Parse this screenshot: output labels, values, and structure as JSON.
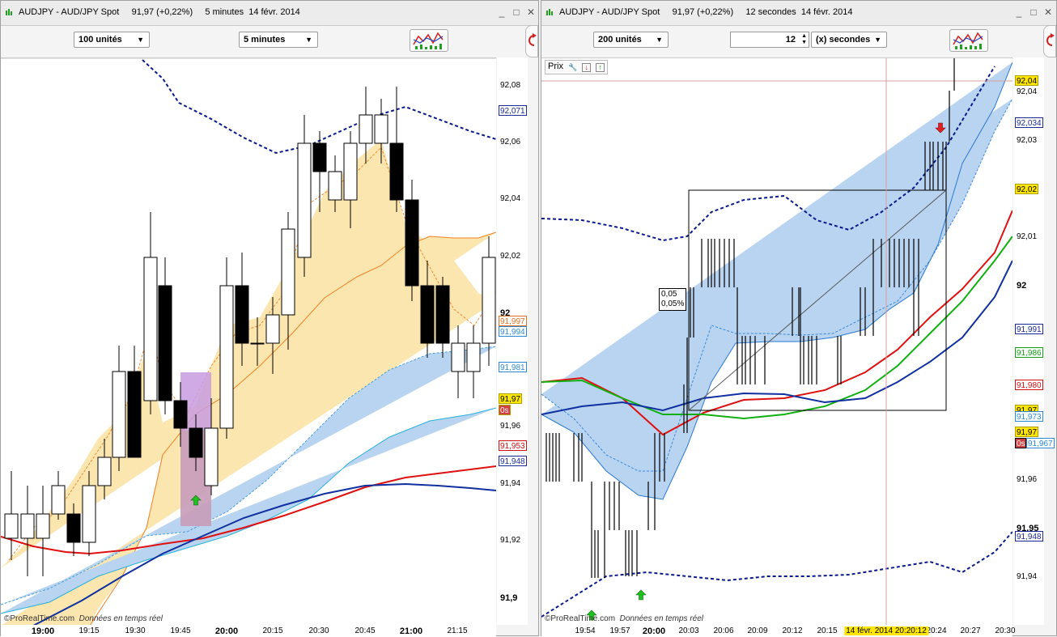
{
  "colors": {
    "bull_candle": "#ffffff",
    "bear_candle": "#000000",
    "bollinger": "#0a1a8c",
    "red_ma": "#e01010",
    "green_ma": "#10b010",
    "blue_ma": "#1030a0",
    "cloud_blue": "#b8d4f0",
    "cloud_yellow": "#fbe6b0",
    "orange_line": "#f08020",
    "highlight_purple": "#c89be0",
    "arrow_up": "#20c020",
    "arrow_down": "#e02020"
  },
  "left_panel": {
    "title": "AUDJPY - AUD/JPY Spot     91,97 (+0,22%)     5 minutes  14 févr. 2014",
    "units_dropdown": "100 unités",
    "timeframe_dropdown": "5 minutes",
    "price_ticks": [
      "92,08",
      "92,06",
      "92,04",
      "92,02",
      "92",
      "91,96",
      "91,94",
      "91,92",
      "91,9"
    ],
    "price_labels": [
      {
        "text": "92,071",
        "color": "#1a2a9a"
      },
      {
        "text": "91,997",
        "color": "#e07020"
      },
      {
        "text": "91,994",
        "color": "#2a8ad8"
      },
      {
        "text": "91,981",
        "color": "#2a8ad8"
      },
      {
        "text": "91,97",
        "color": "#000000"
      },
      {
        "text": "0s",
        "color": "#000000"
      },
      {
        "text": "91,953",
        "color": "#d01010"
      },
      {
        "text": "91,948",
        "color": "#1a2a9a"
      }
    ],
    "time_ticks": [
      "19:00",
      "19:15",
      "19:30",
      "19:45",
      "20:00",
      "20:15",
      "20:30",
      "20:45",
      "21:00",
      "21:15"
    ],
    "bold_time_ticks": [
      "19:00",
      "20:00",
      "21:00"
    ],
    "watermark_brand": "ProRealTime.com",
    "watermark_text": "Données en temps réel"
  },
  "right_panel": {
    "title": "AUDJPY - AUD/JPY Spot     91,97 (+0,22%)     12 secondes  14 févr. 2014",
    "units_dropdown": "200 unités",
    "interval_value": "12",
    "interval_unit": "(x) secondes",
    "prix_label": "Prix",
    "price_ticks": [
      "92,04",
      "92,03",
      "92,01",
      "92",
      "91,96",
      "91,95",
      "91,94"
    ],
    "price_labels": [
      {
        "text": "92,04",
        "color": "#000000"
      },
      {
        "text": "92,034",
        "color": "#1a2a9a"
      },
      {
        "text": "92,02",
        "color": "#000000"
      },
      {
        "text": "91,991",
        "color": "#1a2a9a"
      },
      {
        "text": "91,986",
        "color": "#10a010"
      },
      {
        "text": "91,980",
        "color": "#d01010"
      },
      {
        "text": "91,97",
        "color": "#000000"
      },
      {
        "text": "91,973",
        "color": "#2a8ad8"
      },
      {
        "text": "91,97",
        "color": "#000000"
      },
      {
        "text": "0s",
        "color": "#000000"
      },
      {
        "text": "91,967",
        "color": "#2a8ad8"
      },
      {
        "text": "91,948",
        "color": "#1a2a9a"
      }
    ],
    "annotation_line1": "0,05",
    "annotation_line2": "0,05%",
    "time_ticks": [
      "19:54",
      "19:57",
      "20:00",
      "20:03",
      "20:06",
      "20:09",
      "20:12",
      "20:15",
      "20:24",
      "20:27",
      "20:30"
    ],
    "cursor_time": "14 févr. 2014 20:20:12",
    "watermark_brand": "ProRealTime.com",
    "watermark_text": "Données en temps réel"
  }
}
